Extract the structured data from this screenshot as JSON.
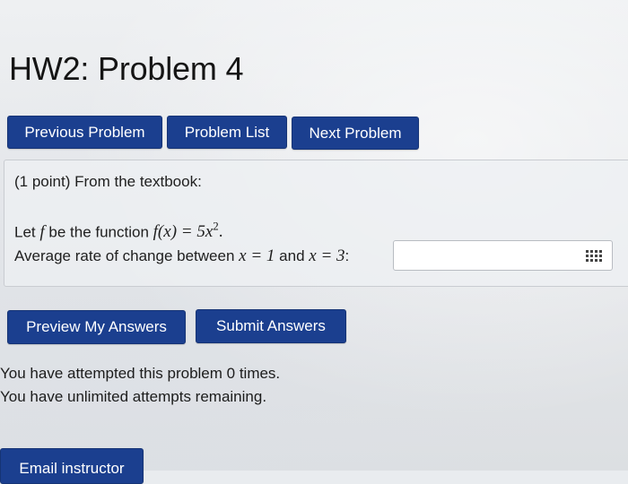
{
  "page": {
    "title": "HW2: Problem 4"
  },
  "nav": {
    "previous_label": "Previous Problem",
    "list_label": "Problem List",
    "next_label": "Next Problem"
  },
  "problem": {
    "intro": "(1 point) From the textbook:",
    "let_prefix": "Let",
    "let_var": "f",
    "let_middle": "be the function",
    "function_lhs": "f(x) = 5x",
    "function_exp": "2",
    "function_end": ".",
    "avg_prefix": "Average rate of change between",
    "x1": "x = 1",
    "and_word": "and",
    "x2": "x = 3",
    "colon": ":",
    "answer_value": "",
    "answer_placeholder": ""
  },
  "icons": {
    "keyboard": "keyboard-icon"
  },
  "actions": {
    "preview_label": "Preview My Answers",
    "submit_label": "Submit Answers",
    "email_label": "Email instructor"
  },
  "status": {
    "attempts": "You have attempted this problem 0 times.",
    "remaining": "You have unlimited attempts remaining."
  },
  "colors": {
    "button_bg": "#1b3f8f",
    "button_text": "#ffffff"
  }
}
